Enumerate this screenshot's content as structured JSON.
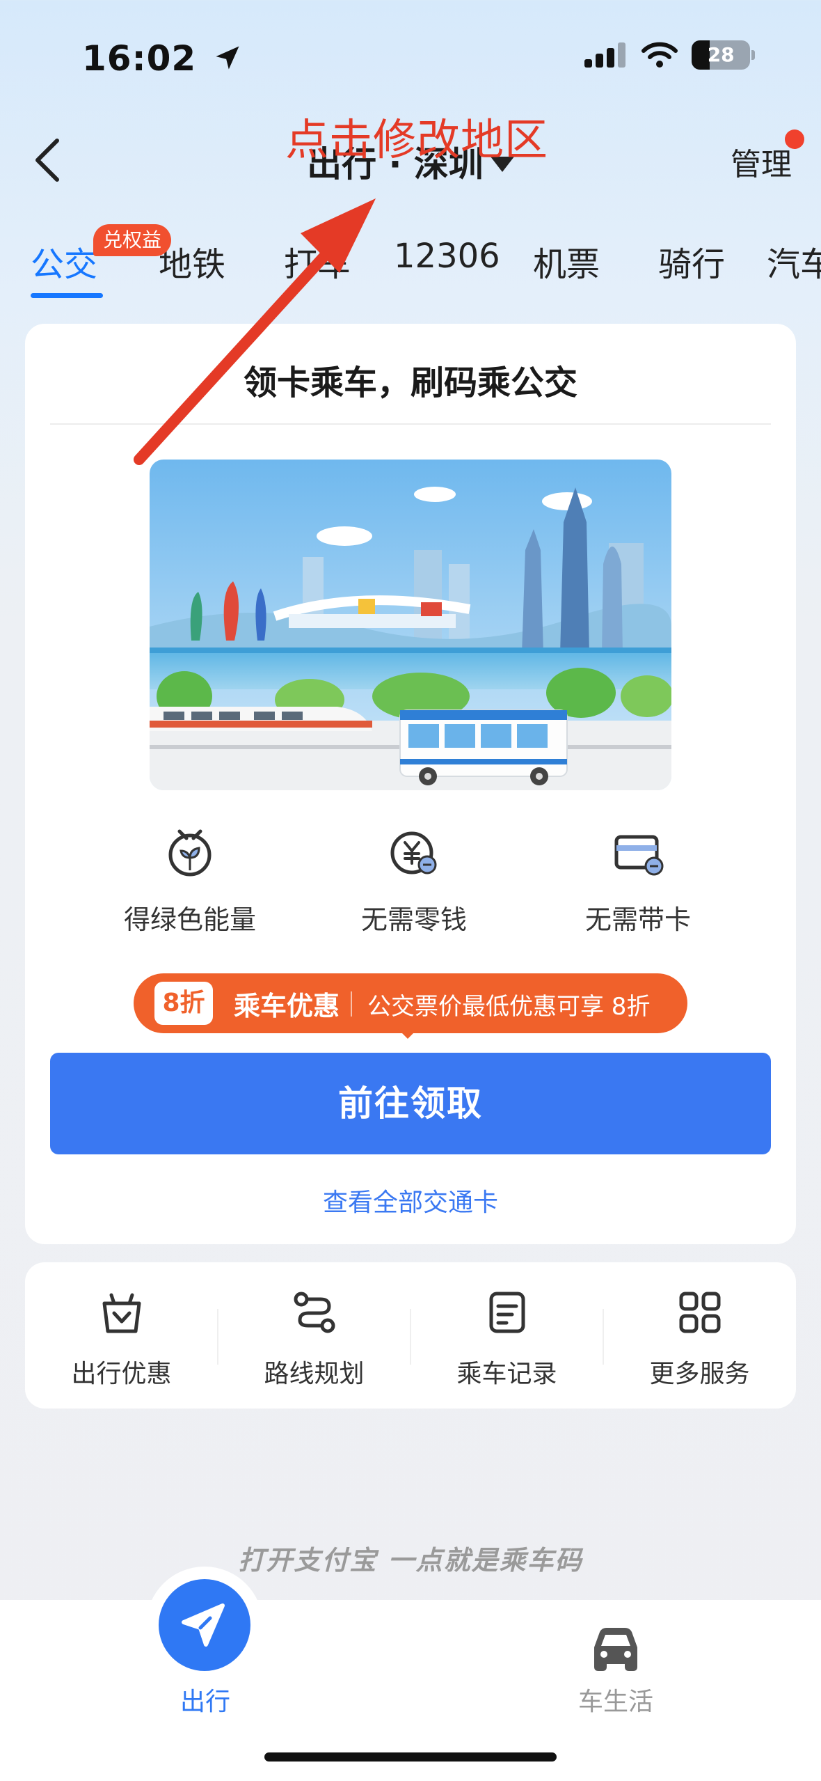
{
  "status_bar": {
    "time": "16:02",
    "battery": "28",
    "icons": [
      "location-arrow-icon",
      "signal-icon",
      "wifi-icon",
      "battery-icon"
    ]
  },
  "header": {
    "title": "出行 · 深圳",
    "manage": "管理",
    "annotation": "点击修改地区",
    "icons": [
      "back-chevron-icon",
      "caret-down-icon"
    ]
  },
  "tabs": {
    "items": [
      "公交",
      "地铁",
      "打车",
      "12306",
      "机票",
      "骑行",
      "汽车"
    ],
    "badge": "兑权益",
    "active": "公交"
  },
  "card": {
    "title": "领卡乘车，刷码乘公交",
    "features": [
      {
        "label": "得绿色能量",
        "icon": "green-energy-icon"
      },
      {
        "label": "无需零钱",
        "icon": "yuan-coin-icon"
      },
      {
        "label": "无需带卡",
        "icon": "card-icon"
      }
    ],
    "promo": {
      "badge": "8折",
      "title": "乘车优惠",
      "desc": "公交票价最低优惠可享 8折"
    },
    "cta": "前往领取",
    "link": "查看全部交通卡"
  },
  "services": [
    {
      "label": "出行优惠",
      "icon": "gift-bag-icon"
    },
    {
      "label": "路线规划",
      "icon": "route-icon"
    },
    {
      "label": "乘车记录",
      "icon": "record-doc-icon"
    },
    {
      "label": "更多服务",
      "icon": "grid-icon"
    }
  ],
  "slogan": "打开支付宝 一点就是乘车码",
  "bottom_nav": {
    "items": [
      {
        "label": "出行",
        "icon": "paper-plane-icon",
        "active": true
      },
      {
        "label": "车生活",
        "icon": "car-icon",
        "active": false
      }
    ]
  },
  "colors": {
    "accent": "#1677ff",
    "cta": "#3a78f2",
    "promo": "#f0612b",
    "annotation": "#e43a26"
  }
}
